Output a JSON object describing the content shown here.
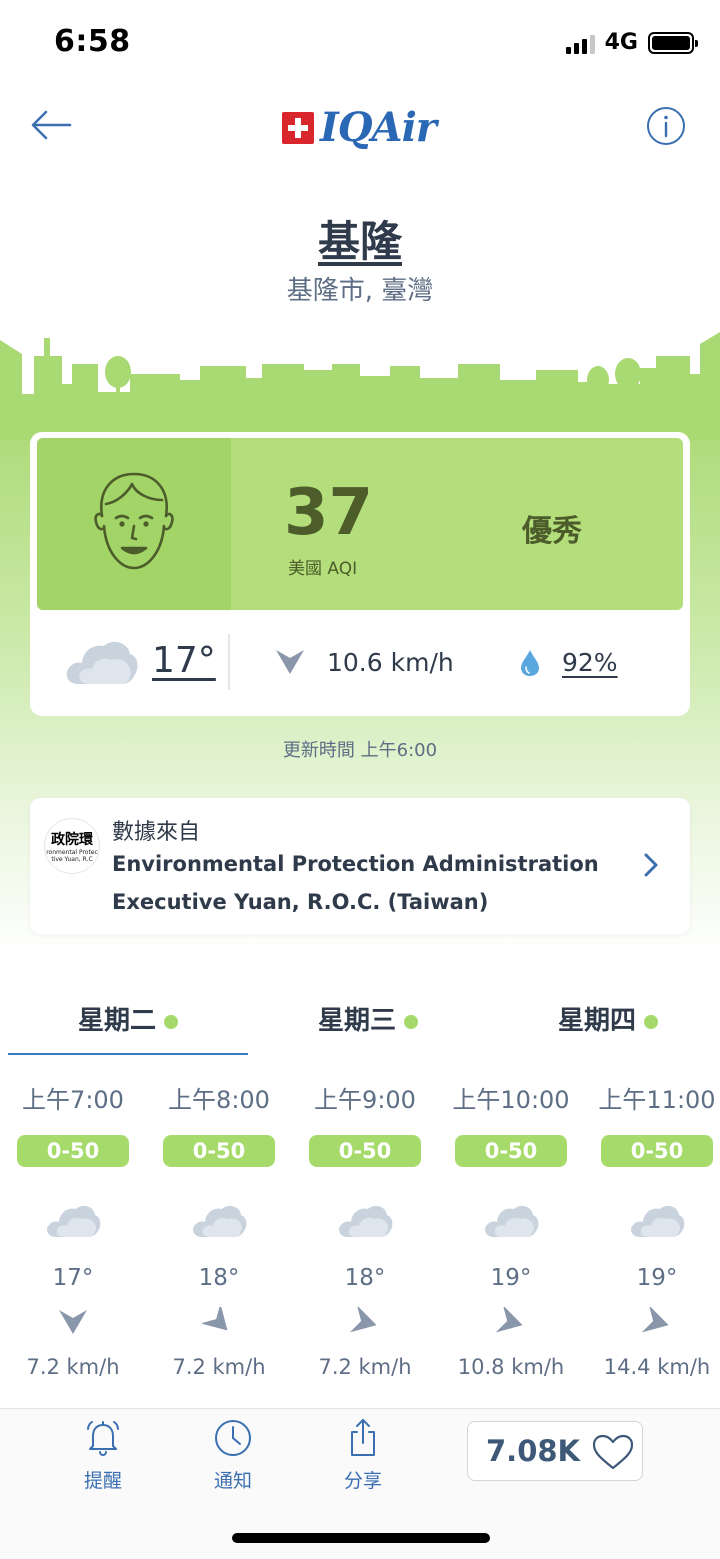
{
  "status_bar": {
    "time": "6:58",
    "network": "4G"
  },
  "header": {
    "brand": "IQAir"
  },
  "location": {
    "city": "基隆",
    "region": "基隆市, 臺灣"
  },
  "aqi": {
    "value": "37",
    "unit_label": "美國 AQI",
    "level": "優秀",
    "colors": {
      "card": "#b4de7b",
      "face_panel": "#a3d468",
      "text": "#4c5c2a"
    }
  },
  "current_conditions": {
    "weather_icon": "cloud-icon",
    "temperature": "17°",
    "wind_icon": "wind-direction-icon",
    "wind_speed": "10.6 km/h",
    "humidity_icon": "water-drop-icon",
    "humidity": "92%"
  },
  "updated": "更新時間 上午6:00",
  "data_source": {
    "label": "數據來自",
    "name_line1": "Environmental Protection Administration",
    "name_line2": "Executive Yuan, R.O.C. (Taiwan)",
    "logo_text": "政院環",
    "logo_subtext": "ronmental Protec",
    "logo_subtext2": "tive Yuan, R.C"
  },
  "day_tabs": [
    {
      "label": "星期二",
      "selected": true
    },
    {
      "label": "星期三",
      "selected": false
    },
    {
      "label": "星期四",
      "selected": false
    }
  ],
  "hourly": [
    {
      "time": "上午7:00",
      "aqi_range": "0-50",
      "icon": "cloud-icon",
      "temp": "17°",
      "wind": "7.2 km/h"
    },
    {
      "time": "上午8:00",
      "aqi_range": "0-50",
      "icon": "cloud-icon",
      "temp": "18°",
      "wind": "7.2 km/h"
    },
    {
      "time": "上午9:00",
      "aqi_range": "0-50",
      "icon": "cloud-icon",
      "temp": "18°",
      "wind": "7.2 km/h"
    },
    {
      "time": "上午10:00",
      "aqi_range": "0-50",
      "icon": "cloud-icon",
      "temp": "19°",
      "wind": "10.8 km/h"
    },
    {
      "time": "上午11:00",
      "aqi_range": "0-50",
      "icon": "cloud-icon",
      "temp": "19°",
      "wind": "14.4 km/h"
    }
  ],
  "bottom_bar": {
    "alert_label": "提醒",
    "notify_label": "通知",
    "share_label": "分享",
    "followers": "7.08K"
  },
  "colors": {
    "accent_blue": "#3b6fb0",
    "aqi_good": "#a6db6c"
  }
}
